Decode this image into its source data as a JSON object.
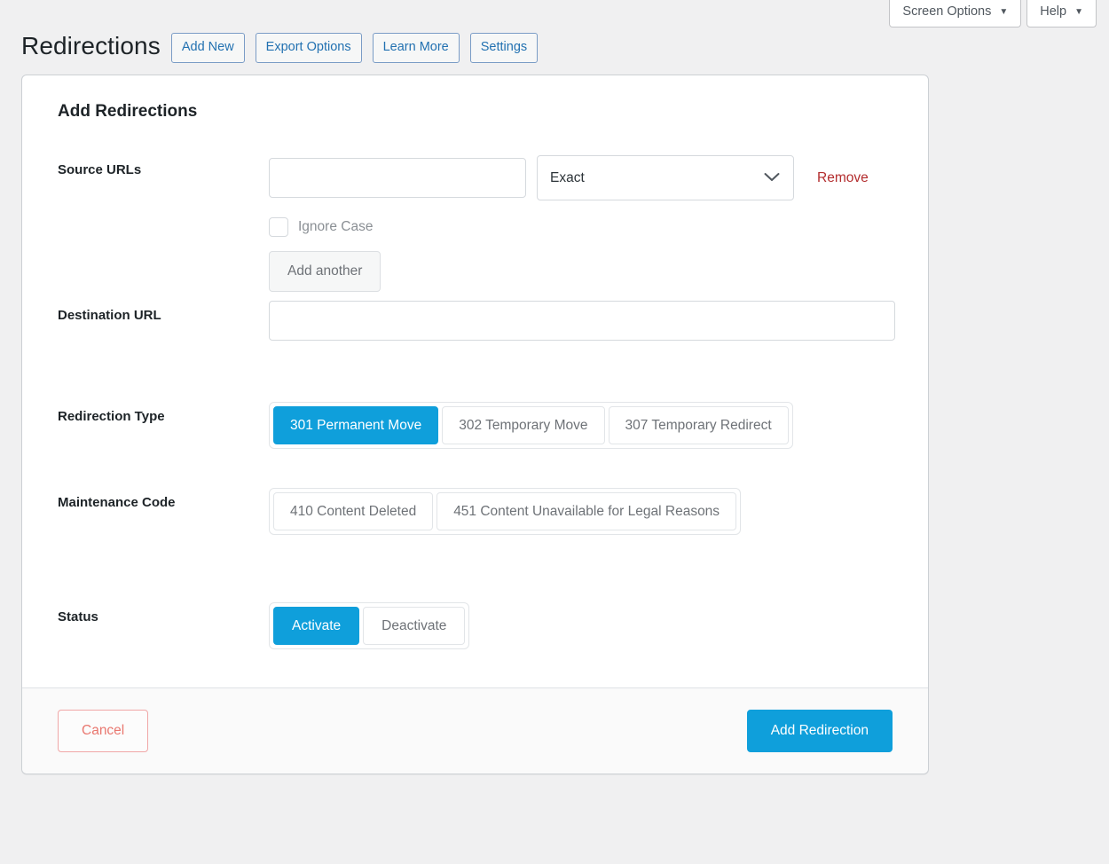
{
  "screen_meta": {
    "screen_options_label": "Screen Options",
    "help_label": "Help",
    "caret_glyph": "▼"
  },
  "header": {
    "title": "Redirections",
    "buttons": [
      {
        "label": "Add New"
      },
      {
        "label": "Export Options"
      },
      {
        "label": "Learn More"
      },
      {
        "label": "Settings"
      }
    ]
  },
  "card": {
    "heading": "Add Redirections",
    "source": {
      "label": "Source URLs",
      "url_value": "",
      "url_placeholder": "",
      "match_selected": "Exact",
      "remove_label": "Remove",
      "ignore_case_label": "Ignore Case",
      "ignore_case_checked": false,
      "add_another_label": "Add another"
    },
    "destination": {
      "label": "Destination URL",
      "value": "",
      "placeholder": ""
    },
    "redirection_type": {
      "label": "Redirection Type",
      "options": [
        {
          "label": "301 Permanent Move",
          "active": true
        },
        {
          "label": "302 Temporary Move",
          "active": false
        },
        {
          "label": "307 Temporary Redirect",
          "active": false
        }
      ]
    },
    "maintenance_code": {
      "label": "Maintenance Code",
      "options": [
        {
          "label": "410 Content Deleted",
          "active": false
        },
        {
          "label": "451 Content Unavailable for Legal Reasons",
          "active": false
        }
      ]
    },
    "status": {
      "label": "Status",
      "options": [
        {
          "label": "Activate",
          "active": true
        },
        {
          "label": "Deactivate",
          "active": false
        }
      ]
    },
    "footer": {
      "cancel_label": "Cancel",
      "submit_label": "Add Redirection"
    }
  },
  "colors": {
    "accent_blue": "#0f9fdb",
    "link_blue": "#2271b1",
    "remove_red": "#b32d2e",
    "cancel_red": "#e9776f",
    "page_bg": "#f0f0f1"
  }
}
